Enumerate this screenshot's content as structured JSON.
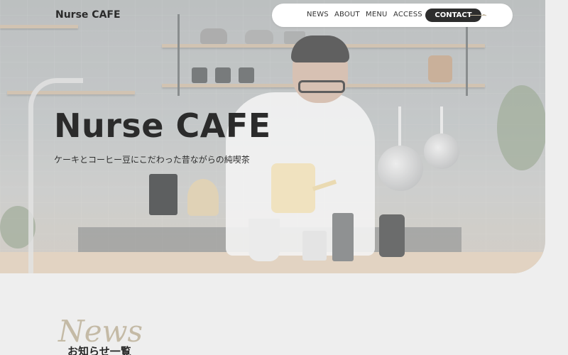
{
  "header": {
    "logo": "Nurse CAFE",
    "nav": [
      {
        "label": "NEWS"
      },
      {
        "label": "ABOUT"
      },
      {
        "label": "MENU"
      },
      {
        "label": "ACCESS"
      }
    ],
    "contact_label": "CONTACT"
  },
  "hero": {
    "title": "Nurse CAFE",
    "tagline": "ケーキとコーヒー豆にこだわった昔ながらの純喫茶"
  },
  "news": {
    "script_title": "News",
    "heading": "お知らせ一覧"
  },
  "colors": {
    "background": "#eeeeee",
    "accent": "#bdb29a",
    "dark": "#2d2d2d",
    "nav_bg": "#ffffff"
  },
  "icons": {
    "contact_arrow": "arrow-right-icon"
  }
}
